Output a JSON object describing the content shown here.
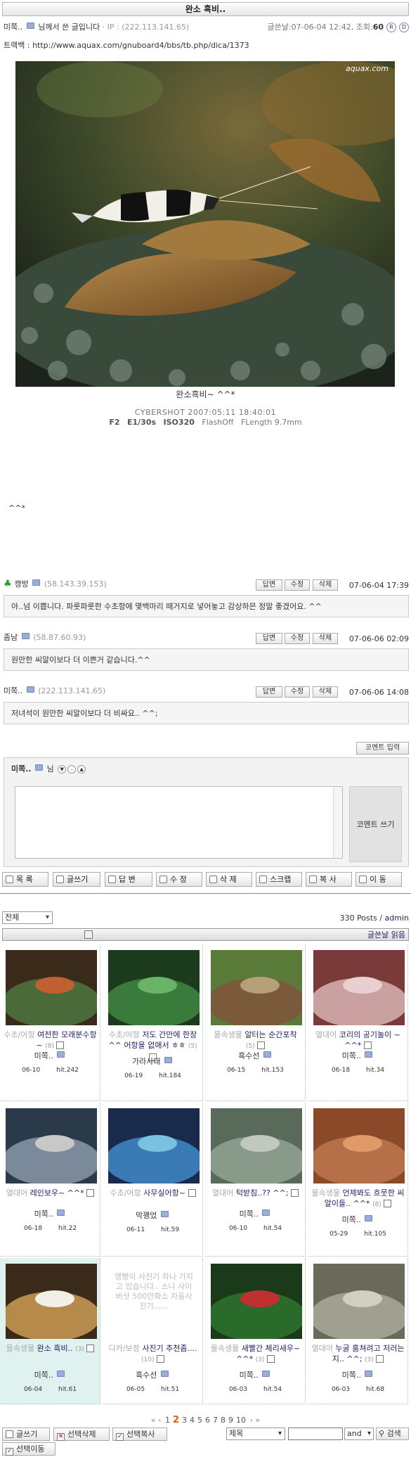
{
  "post": {
    "title": "완소 흑비..",
    "author": "미쪽..",
    "subject": "님께서 쓴 글입니다",
    "ip": "· IP : (222.113.141.65)",
    "date_label": "글쓴날:07-06-04 12:42, 조회:",
    "views": "60",
    "trackback_label": "트랙백 :",
    "trackback_url": "http://www.aquax.com/gnuboard4/bbs/tb.php/dica/1373",
    "watermark": "aquax.com",
    "caption": "완소흑비~ ^^*",
    "exif_line1": "CYBERSHOT    2007:05:11 18:40:01",
    "exif_f": "F2",
    "exif_e": "E1/30s",
    "exif_iso": "ISO320",
    "exif_flash": "FlashOff",
    "exif_flen": "FLength 9.7mm",
    "body": "^^*"
  },
  "comment_buttons": {
    "reply": "답변",
    "edit": "수정",
    "delete": "삭제"
  },
  "comments": [
    {
      "name": "캥방",
      "ip": "(58.143.39.153)",
      "date": "07-06-04 17:39",
      "text": "아..넘 이쁩니다. 파릇파릇한 수초항에 몇백마리 떼거지로 넣어놓고 감상하믄 정말 좋겠어요. ^^"
    },
    {
      "name": "좀남",
      "ip": "(58.87.60.93)",
      "date": "07-06-06 02:09",
      "text": "원만한 씨알이보다 더 이쁜거 같습니다.^^"
    },
    {
      "name": "미쪽..",
      "ip": "(222.113.141.65)",
      "date": "07-06-06 14:08",
      "text": "저녀석이 원만한 씨알이보다 더 비싸요.. ^^;"
    }
  ],
  "comment_form": {
    "input_label": "코멘트 입력",
    "name": "미쪽..",
    "suffix": "님",
    "write_label": "코멘트 쓰기"
  },
  "toolbar": [
    "목 록",
    "글쓰기",
    "답 변",
    "수 정",
    "삭 제",
    "스크랩",
    "복 사",
    "이 동"
  ],
  "list": {
    "category": "전체",
    "posts_count": "330 Posts /",
    "admin": "admin",
    "sort_label": "글쓴날 읽음"
  },
  "gallery": [
    {
      "cat": "수초/어항",
      "title": "여전한 모래분수항~",
      "cnt": "(8)",
      "author": "미쪽..",
      "date": "06-10",
      "hit": "hit.242"
    },
    {
      "cat": "수초/어항",
      "title": "저도 간만에 한장 ^^ 어항을 없애서 ㅎㅎ",
      "cnt": "(5)",
      "author": "가라사대",
      "date": "06-19",
      "hit": "hit.184"
    },
    {
      "cat": "물속생물",
      "title": "알터는 순간포착",
      "cnt": "(5)",
      "author": "흑수선",
      "date": "06-15",
      "hit": "hit.153"
    },
    {
      "cat": "열대어",
      "title": "코리의 공기놀이 ~ ^^*",
      "cnt": "",
      "author": "미쪽..",
      "date": "06-18",
      "hit": "hit.34"
    },
    {
      "cat": "열대어",
      "title": "레인보우~ ^^*",
      "cnt": "",
      "author": "미쪽..",
      "date": "06-18",
      "hit": "hit.22"
    },
    {
      "cat": "수초/어항",
      "title": "사무실어항~",
      "cnt": "",
      "author": "막꽹었",
      "date": "06-11",
      "hit": "hit.59"
    },
    {
      "cat": "열대어",
      "title": "턱받침..?? ^^;",
      "cnt": "",
      "author": "미쪽..",
      "date": "06-10",
      "hit": "hit.54"
    },
    {
      "cat": "물속생물",
      "title": "언제봐도 흐뭇한 씨알이들.. ^^*",
      "cnt": "(8)",
      "author": "미쪽..",
      "date": "05-29",
      "hit": "hit.105"
    },
    {
      "cat": "물속생물",
      "title": "완소 흑비..",
      "cnt": "(3)",
      "author": "미쪽..",
      "date": "06-04",
      "hit": "hit.61"
    },
    {
      "cat": "디카/보정",
      "title": "사진기 추천좀....",
      "cnt": "(10)",
      "author": "흑수선",
      "date": "06-05",
      "hit": "hit.51",
      "preview": "캥빵이 사진기 하나 가지고 있습니다.. 소니 사이버샷 500만화소 자동사진기......"
    },
    {
      "cat": "물속생물",
      "title": "새빨간 체리새우~ ^^*",
      "cnt": "(3)",
      "author": "미쪽..",
      "date": "06-03",
      "hit": "hit.54"
    },
    {
      "cat": "열대어",
      "title": "누굴 훔쳐려고 저러는지.. ^^;",
      "cnt": "(3)",
      "author": "미쪽..",
      "date": "06-03",
      "hit": "hit.68"
    }
  ],
  "pager": {
    "first": "«",
    "prev": "‹",
    "pages": [
      "1",
      "2",
      "3",
      "4",
      "5",
      "6",
      "7",
      "8",
      "9",
      "10"
    ],
    "current": "2",
    "next": "›",
    "last": "»"
  },
  "bottom": {
    "write": "글쓰기",
    "sel_delete": "선택삭제",
    "sel_copy": "선택복사",
    "sel_move": "선택이동",
    "search_field": "제목",
    "search_op": "and",
    "search_button": "검색"
  },
  "colors": {
    "accent": "#226",
    "highlight": "#e0f2f0",
    "current_page": "#e05a00"
  }
}
